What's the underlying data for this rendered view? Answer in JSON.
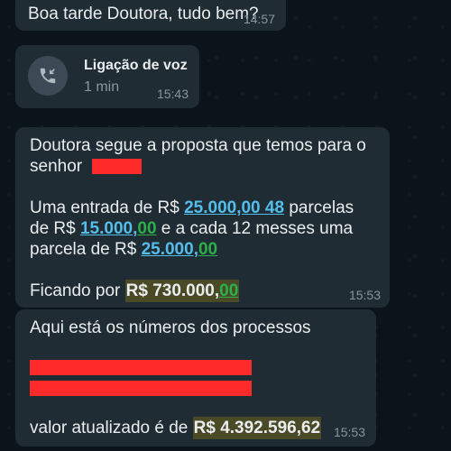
{
  "messages": [
    {
      "text": "Boa tarde Doutora, tudo bem?",
      "time": "14:57"
    },
    {
      "call_title": "Ligação de voz",
      "call_duration": "1 min",
      "time": "15:43",
      "icon": "missed-call-icon"
    },
    {
      "line1": "Doutora segue a proposta que temos para o",
      "line2": "senhor",
      "line3_a": "Uma entrada de R$ ",
      "line3_link": "25.000,00 48",
      "line3_b": " parcelas",
      "line4_a": "de R$ ",
      "line4_link": "15.000,",
      "line4_link2": "00",
      "line4_b": " e a cada 12 messes uma",
      "line5_a": "parcela de R$ ",
      "line5_link": "25.000,",
      "line5_link2": "00",
      "line6_a": "Ficando por ",
      "line6_hl": "R$ 730.000,",
      "line6_hl2": "00",
      "time": "15:53"
    },
    {
      "line1": "Aqui está os números dos processos",
      "line_last_a": "valor atualizado é de ",
      "line_last_hl": "R$ 4.392.596,62",
      "time": "15:53"
    }
  ],
  "colors": {
    "bubble": "#202c33",
    "link": "#53bdeb",
    "highlight": "#4a4a26",
    "redaction": "#ff2a2a"
  }
}
